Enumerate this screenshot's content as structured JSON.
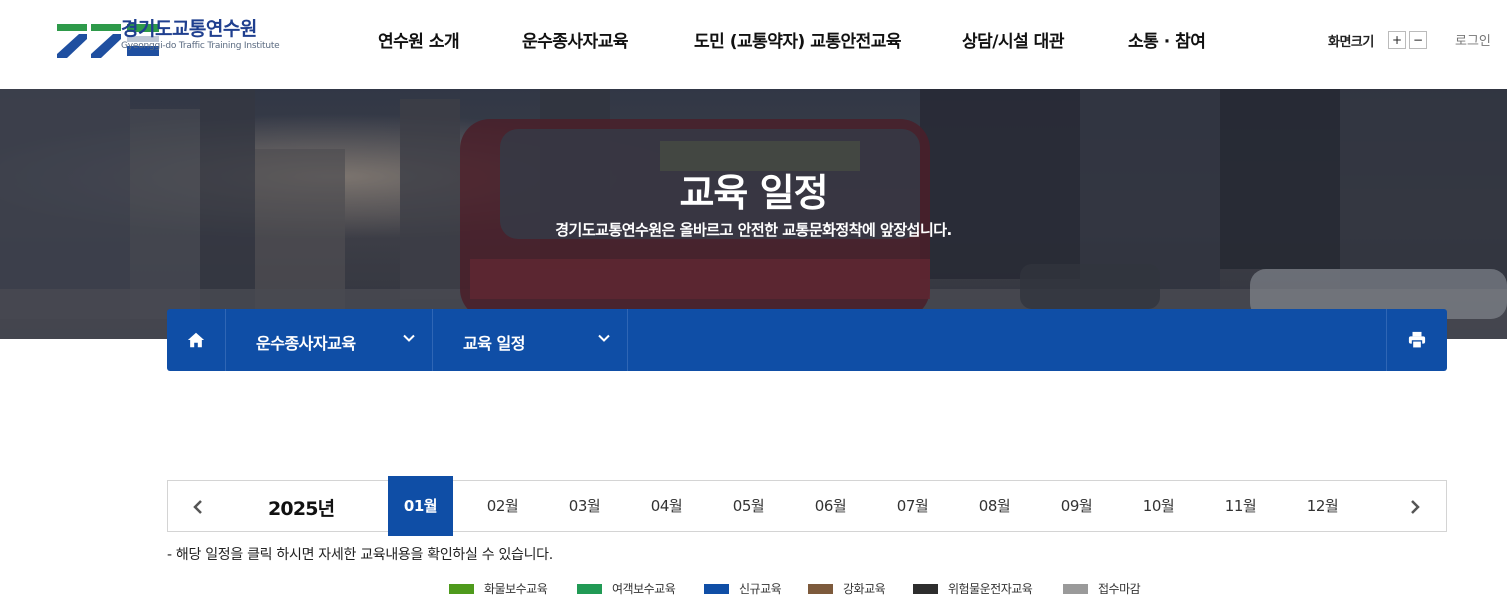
{
  "header": {
    "logo_ko": "경기도교통연수원",
    "logo_en": "Gyeonggi-do Traffic Training Institute",
    "nav": [
      {
        "label": "연수원 소개"
      },
      {
        "label": "운수종사자교육"
      },
      {
        "label": "도민 (교통약자) 교통안전교육"
      },
      {
        "label": "상담/시설 대관"
      },
      {
        "label": "소통 · 참여"
      }
    ],
    "font_size_label": "화면크기",
    "font_plus": "+",
    "font_minus": "−",
    "login": "로그인"
  },
  "hero": {
    "title": "교육 일정",
    "subtitle": "경기도교통연수원은 올바르고 안전한 교통문화정착에 앞장섭니다."
  },
  "location": {
    "home_icon": "home-icon",
    "depth1": "운수종사자교육",
    "depth2": "교육 일정",
    "print_icon": "print-icon"
  },
  "calendar": {
    "year_label": "2025년",
    "months": [
      "01월",
      "02월",
      "03월",
      "04월",
      "05월",
      "06월",
      "07월",
      "08월",
      "09월",
      "10월",
      "11월",
      "12월"
    ],
    "active_month": "01월",
    "note": "- 해당 일정을 클릭 하시면 자세한 교육내용을 확인하실 수 있습니다."
  },
  "legend": [
    {
      "label": "화물보수교육",
      "color": "#4e9a1c"
    },
    {
      "label": "여객보수교육",
      "color": "#219a55"
    },
    {
      "label": "신규교육",
      "color": "#0f4ea6"
    },
    {
      "label": "강화교육",
      "color": "#7d5a3c"
    },
    {
      "label": "위험물운전자교육",
      "color": "#2d2d2d"
    },
    {
      "label": "접수마감",
      "color": "#9a9a9a"
    }
  ],
  "colors": {
    "brand_blue": "#0f4ea6",
    "brand_green": "#2e9a4a"
  }
}
